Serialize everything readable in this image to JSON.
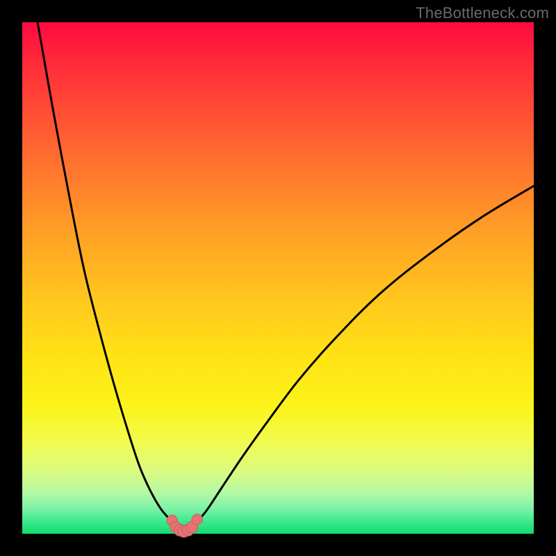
{
  "watermark": "TheBottleneck.com",
  "colors": {
    "frame": "#000000",
    "curve_stroke": "#000000",
    "marker_fill": "#e47474",
    "marker_stroke": "#cf5b5b"
  },
  "chart_data": {
    "type": "line",
    "title": "",
    "xlabel": "",
    "ylabel": "",
    "xlim": [
      0,
      100
    ],
    "ylim": [
      0,
      100
    ],
    "grid": false,
    "legend": false,
    "series": [
      {
        "name": "left-branch",
        "x": [
          3,
          6,
          9,
          12,
          15,
          18,
          21,
          23,
          25,
          27,
          28.5,
          29.5
        ],
        "y": [
          100,
          83,
          67,
          52,
          40,
          29,
          19,
          13,
          8.5,
          5,
          3.2,
          2.2
        ]
      },
      {
        "name": "right-branch",
        "x": [
          34,
          36,
          39,
          43,
          48,
          54,
          61,
          70,
          80,
          90,
          100
        ],
        "y": [
          2.2,
          4.5,
          9,
          15,
          22,
          30,
          38,
          47,
          55,
          62,
          68
        ]
      },
      {
        "name": "trough",
        "x": [
          29.5,
          30,
          30.8,
          31.6,
          32.4,
          33.2,
          34
        ],
        "y": [
          2.2,
          1.1,
          0.55,
          0.4,
          0.55,
          1.1,
          2.2
        ]
      }
    ],
    "markers": {
      "name": "trough-markers",
      "x": [
        29.3,
        30.0,
        30.8,
        31.6,
        32.4,
        33.2,
        34.2
      ],
      "y": [
        2.6,
        1.3,
        0.7,
        0.5,
        0.7,
        1.3,
        2.8
      ],
      "r": [
        1.0,
        1.1,
        1.2,
        1.3,
        1.2,
        1.2,
        1.0
      ]
    }
  }
}
